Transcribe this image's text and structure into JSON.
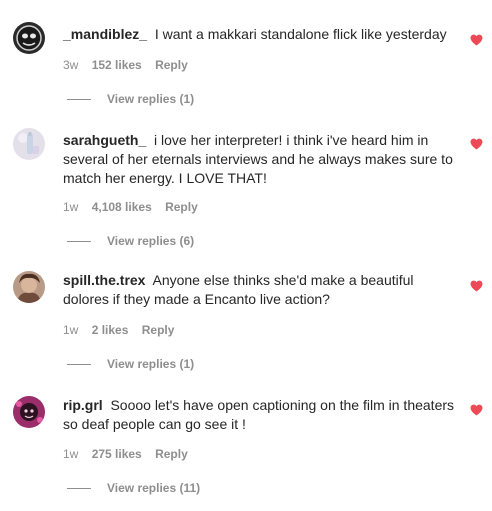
{
  "colors": {
    "heart": "#ed4956",
    "secondary_text": "#8e8e8e",
    "primary_text": "#262626"
  },
  "comments": [
    {
      "username": "_mandiblez_",
      "text": "I want a makkari standalone flick like yesterday",
      "time": "3w",
      "likes": "152 likes",
      "reply": "Reply",
      "view_replies": "View replies (1)",
      "liked": true,
      "avatar_icon": "avatar-icon"
    },
    {
      "username": "sarahgueth_",
      "text": "i love her interpreter! i think i've heard him in several of her eternals interviews and he always makes sure to match her energy. I LOVE THAT!",
      "time": "1w",
      "likes": "4,108 likes",
      "reply": "Reply",
      "view_replies": "View replies (6)",
      "liked": true,
      "avatar_icon": "avatar-icon"
    },
    {
      "username": "spill.the.trex",
      "text": "Anyone else thinks she'd make a beautiful dolores if they made a Encanto live action?",
      "time": "1w",
      "likes": "2 likes",
      "reply": "Reply",
      "view_replies": "View replies (1)",
      "liked": true,
      "avatar_icon": "avatar-icon"
    },
    {
      "username": "rip.grl",
      "text": "Soooo let's have open captioning on the film in theaters so deaf people can go see it !",
      "time": "1w",
      "likes": "275 likes",
      "reply": "Reply",
      "view_replies": "View replies (11)",
      "liked": true,
      "avatar_icon": "avatar-icon"
    }
  ]
}
